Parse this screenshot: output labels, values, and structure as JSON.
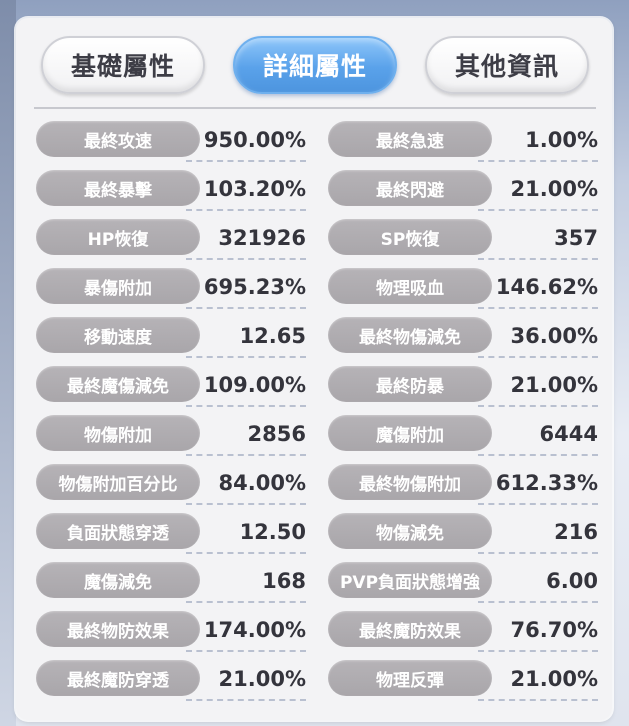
{
  "tabs": [
    {
      "label": "基礎屬性",
      "active": false
    },
    {
      "label": "詳細屬性",
      "active": true
    },
    {
      "label": "其他資訊",
      "active": false
    }
  ],
  "stats": {
    "left": [
      {
        "label": "最終攻速",
        "value": "950.00%"
      },
      {
        "label": "最終暴擊",
        "value": "103.20%"
      },
      {
        "label": "HP恢復",
        "value": "321926"
      },
      {
        "label": "暴傷附加",
        "value": "695.23%"
      },
      {
        "label": "移動速度",
        "value": "12.65"
      },
      {
        "label": "最終魔傷減免",
        "value": "109.00%"
      },
      {
        "label": "物傷附加",
        "value": "2856"
      },
      {
        "label": "物傷附加百分比",
        "value": "84.00%"
      },
      {
        "label": "負面狀態穿透",
        "value": "12.50"
      },
      {
        "label": "魔傷減免",
        "value": "168"
      },
      {
        "label": "最終物防效果",
        "value": "174.00%"
      },
      {
        "label": "最終魔防穿透",
        "value": "21.00%"
      }
    ],
    "right": [
      {
        "label": "最終急速",
        "value": "1.00%"
      },
      {
        "label": "最終閃避",
        "value": "21.00%"
      },
      {
        "label": "SP恢復",
        "value": "357"
      },
      {
        "label": "物理吸血",
        "value": "146.62%"
      },
      {
        "label": "最終物傷減免",
        "value": "36.00%"
      },
      {
        "label": "最終防暴",
        "value": "21.00%"
      },
      {
        "label": "魔傷附加",
        "value": "6444"
      },
      {
        "label": "最終物傷附加",
        "value": "612.33%"
      },
      {
        "label": "物傷減免",
        "value": "216"
      },
      {
        "label": "PVP負面狀態增強",
        "value": "6.00"
      },
      {
        "label": "最終魔防效果",
        "value": "76.70%"
      },
      {
        "label": "物理反彈",
        "value": "21.00%"
      }
    ]
  },
  "colors": {
    "active_tab": "#5aa2ea",
    "label_pill": "#aeabaf",
    "panel_bg": "#f3f3f5",
    "value_text": "#34343c"
  }
}
